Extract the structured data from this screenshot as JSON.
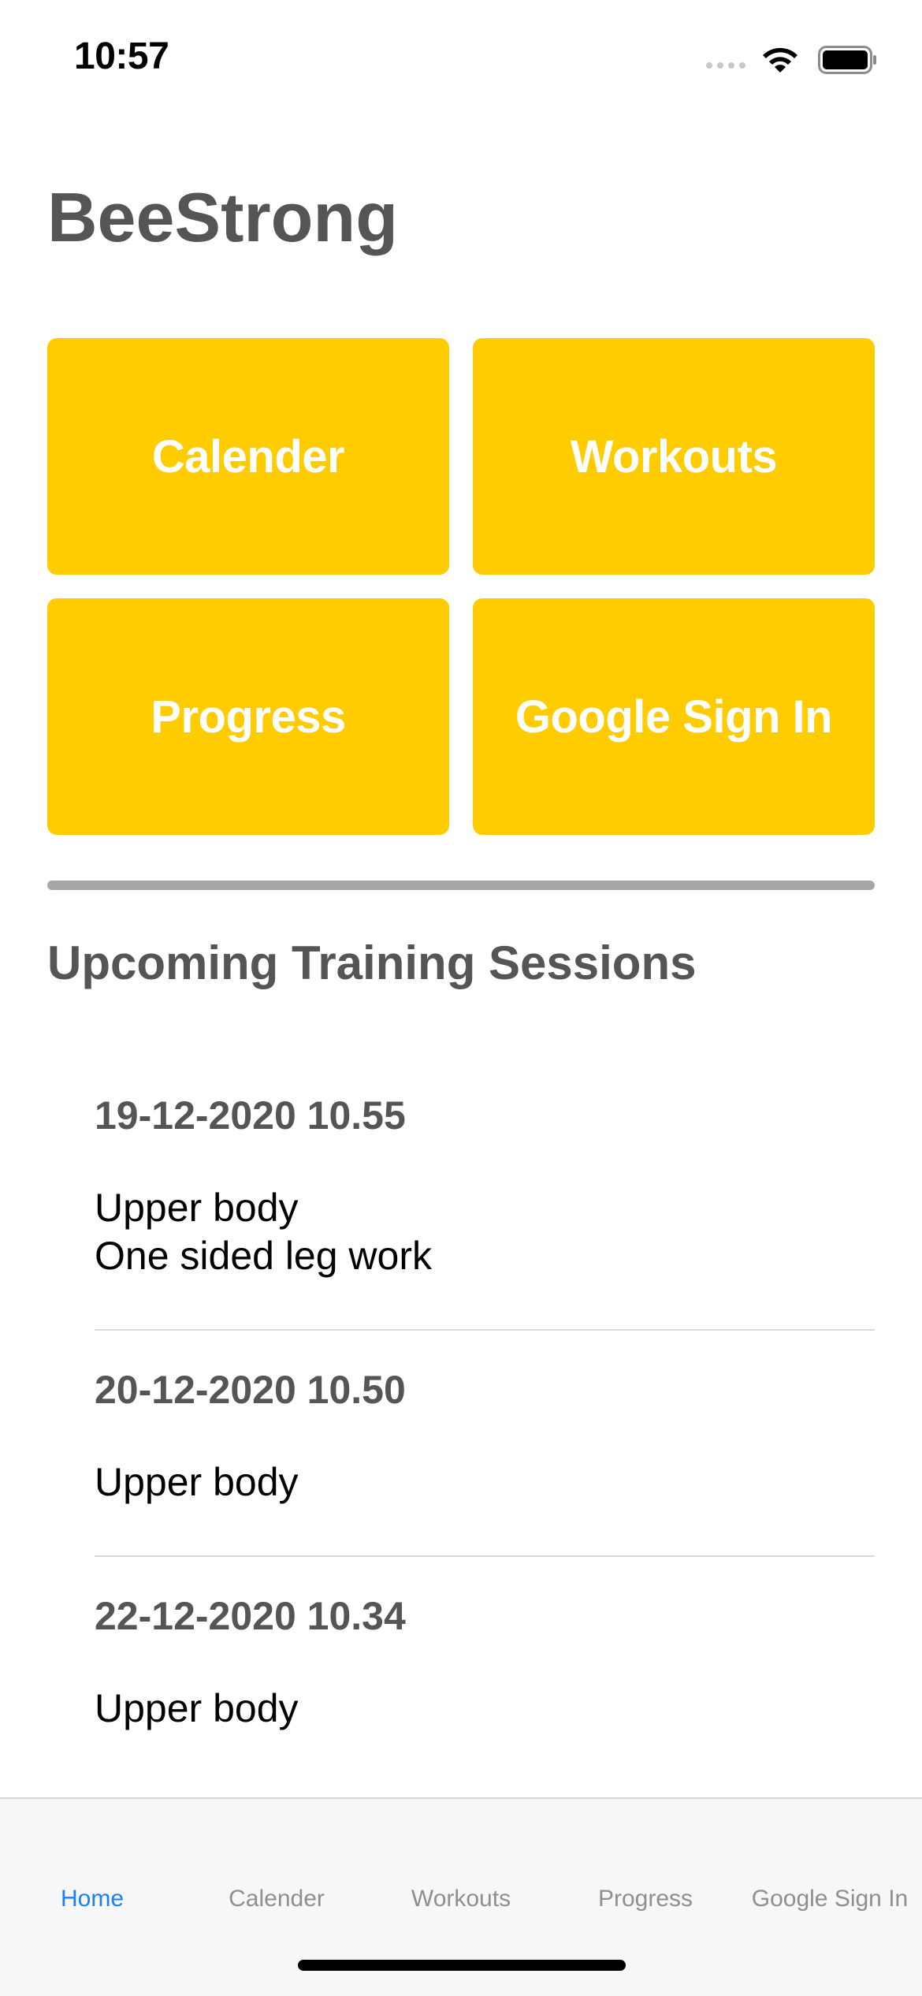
{
  "status_bar": {
    "time": "10:57"
  },
  "app": {
    "title": "BeeStrong",
    "accent_color": "#fecc00"
  },
  "tiles": [
    {
      "label": "Calender"
    },
    {
      "label": "Workouts"
    },
    {
      "label": "Progress"
    },
    {
      "label": "Google Sign In"
    }
  ],
  "upcoming": {
    "heading": "Upcoming Training Sessions",
    "sessions": [
      {
        "date": "19-12-2020 10.55",
        "exercises": [
          "Upper body",
          "One sided leg work"
        ]
      },
      {
        "date": "20-12-2020 10.50",
        "exercises": [
          "Upper body"
        ]
      },
      {
        "date": "22-12-2020 10.34",
        "exercises": [
          "Upper body"
        ]
      }
    ]
  },
  "tab_bar": {
    "active_color": "#1a7ff5",
    "tabs": [
      {
        "label": "Home",
        "active": true
      },
      {
        "label": "Calender",
        "active": false
      },
      {
        "label": "Workouts",
        "active": false
      },
      {
        "label": "Progress",
        "active": false
      },
      {
        "label": "Google Sign In",
        "active": false
      }
    ]
  }
}
